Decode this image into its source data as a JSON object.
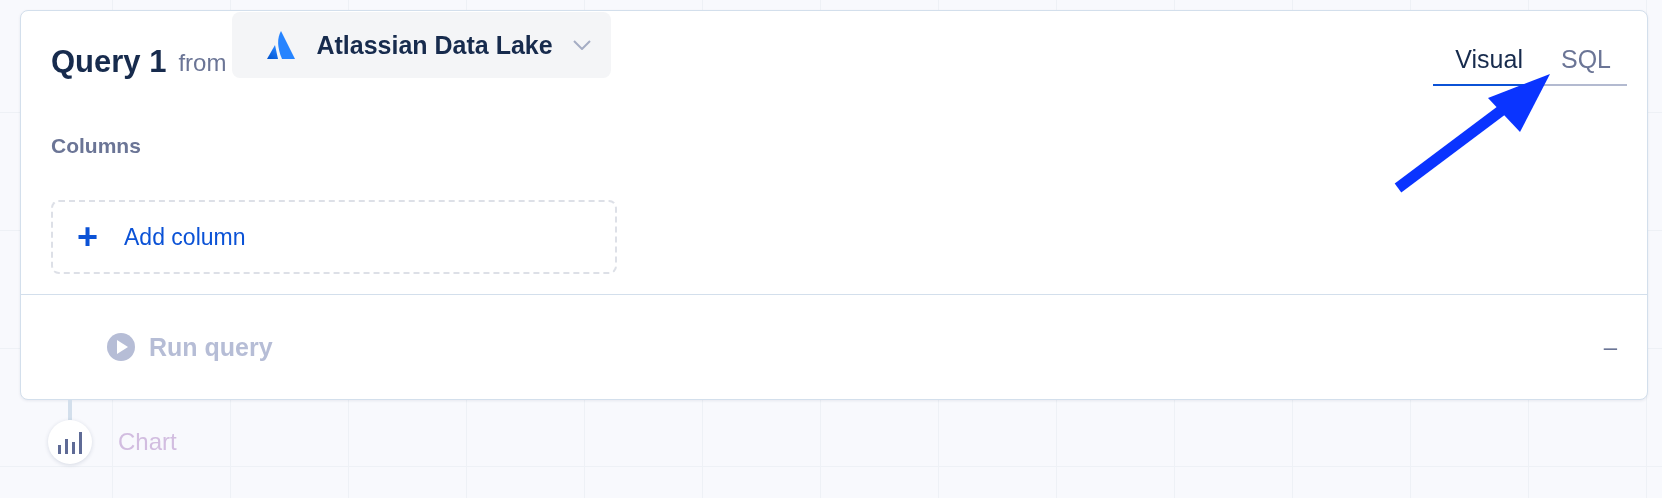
{
  "query": {
    "title": "Query 1",
    "from_label": "from",
    "source": "Atlassian Data Lake",
    "tabs": [
      {
        "label": "Visual",
        "selected": true
      },
      {
        "label": "SQL",
        "selected": false
      }
    ],
    "columns_label": "Columns",
    "add_column": {
      "icon": "+",
      "label": "Add column"
    },
    "run": {
      "label": "Run query",
      "disabled": true
    },
    "collapse": "–"
  },
  "next_step": {
    "label": "Chart"
  }
}
